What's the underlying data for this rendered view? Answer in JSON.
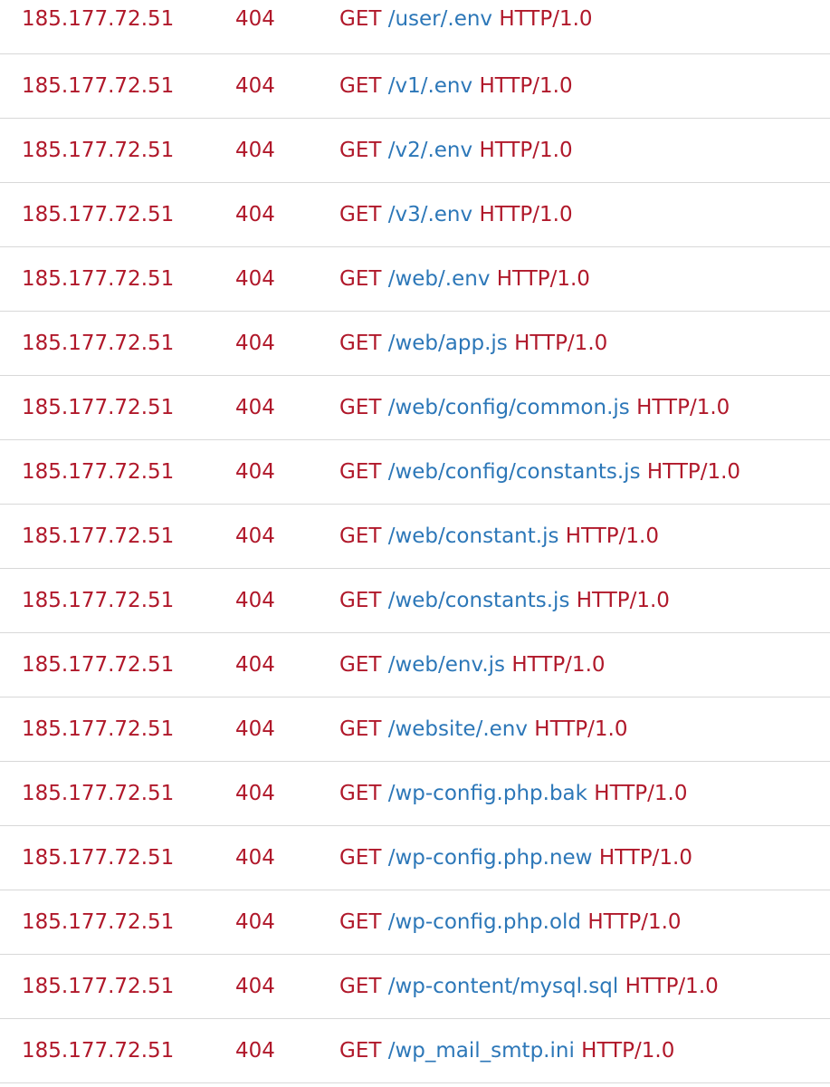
{
  "colors": {
    "text_red": "#b0182a",
    "link_blue": "#2c77b8",
    "divider": "#d8d8d8",
    "background": "#ffffff"
  },
  "log": {
    "rows": [
      {
        "ip": "185.177.72.51",
        "status": "404",
        "method": "GET",
        "path": "/user/.env",
        "protocol": "HTTP/1.0"
      },
      {
        "ip": "185.177.72.51",
        "status": "404",
        "method": "GET",
        "path": "/v1/.env",
        "protocol": "HTTP/1.0"
      },
      {
        "ip": "185.177.72.51",
        "status": "404",
        "method": "GET",
        "path": "/v2/.env",
        "protocol": "HTTP/1.0"
      },
      {
        "ip": "185.177.72.51",
        "status": "404",
        "method": "GET",
        "path": "/v3/.env",
        "protocol": "HTTP/1.0"
      },
      {
        "ip": "185.177.72.51",
        "status": "404",
        "method": "GET",
        "path": "/web/.env",
        "protocol": "HTTP/1.0"
      },
      {
        "ip": "185.177.72.51",
        "status": "404",
        "method": "GET",
        "path": "/web/app.js",
        "protocol": "HTTP/1.0"
      },
      {
        "ip": "185.177.72.51",
        "status": "404",
        "method": "GET",
        "path": "/web/config/common.js",
        "protocol": "HTTP/1.0"
      },
      {
        "ip": "185.177.72.51",
        "status": "404",
        "method": "GET",
        "path": "/web/config/constants.js",
        "protocol": "HTTP/1.0"
      },
      {
        "ip": "185.177.72.51",
        "status": "404",
        "method": "GET",
        "path": "/web/constant.js",
        "protocol": "HTTP/1.0"
      },
      {
        "ip": "185.177.72.51",
        "status": "404",
        "method": "GET",
        "path": "/web/constants.js",
        "protocol": "HTTP/1.0"
      },
      {
        "ip": "185.177.72.51",
        "status": "404",
        "method": "GET",
        "path": "/web/env.js",
        "protocol": "HTTP/1.0"
      },
      {
        "ip": "185.177.72.51",
        "status": "404",
        "method": "GET",
        "path": "/website/.env",
        "protocol": "HTTP/1.0"
      },
      {
        "ip": "185.177.72.51",
        "status": "404",
        "method": "GET",
        "path": "/wp-config.php.bak",
        "protocol": "HTTP/1.0"
      },
      {
        "ip": "185.177.72.51",
        "status": "404",
        "method": "GET",
        "path": "/wp-config.php.new",
        "protocol": "HTTP/1.0"
      },
      {
        "ip": "185.177.72.51",
        "status": "404",
        "method": "GET",
        "path": "/wp-config.php.old",
        "protocol": "HTTP/1.0"
      },
      {
        "ip": "185.177.72.51",
        "status": "404",
        "method": "GET",
        "path": "/wp-content/mysql.sql",
        "protocol": "HTTP/1.0"
      },
      {
        "ip": "185.177.72.51",
        "status": "404",
        "method": "GET",
        "path": "/wp_mail_smtp.ini",
        "protocol": "HTTP/1.0"
      }
    ]
  }
}
